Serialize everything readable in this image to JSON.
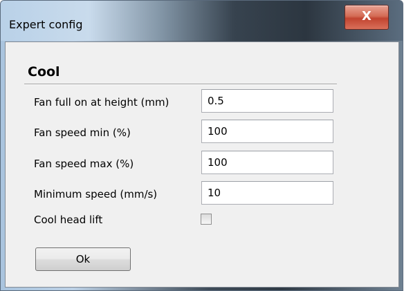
{
  "window": {
    "title": "Expert config",
    "close_label": "X"
  },
  "section": {
    "title": "Cool"
  },
  "fields": [
    {
      "label": "Fan full on at height (mm)",
      "value": "0.5"
    },
    {
      "label": "Fan speed min (%)",
      "value": "100"
    },
    {
      "label": "Fan speed max (%)",
      "value": "100"
    },
    {
      "label": "Minimum speed (mm/s)",
      "value": "10"
    }
  ],
  "cool_head_lift": {
    "label": "Cool head lift",
    "checked": false
  },
  "buttons": {
    "ok_label": "Ok"
  }
}
